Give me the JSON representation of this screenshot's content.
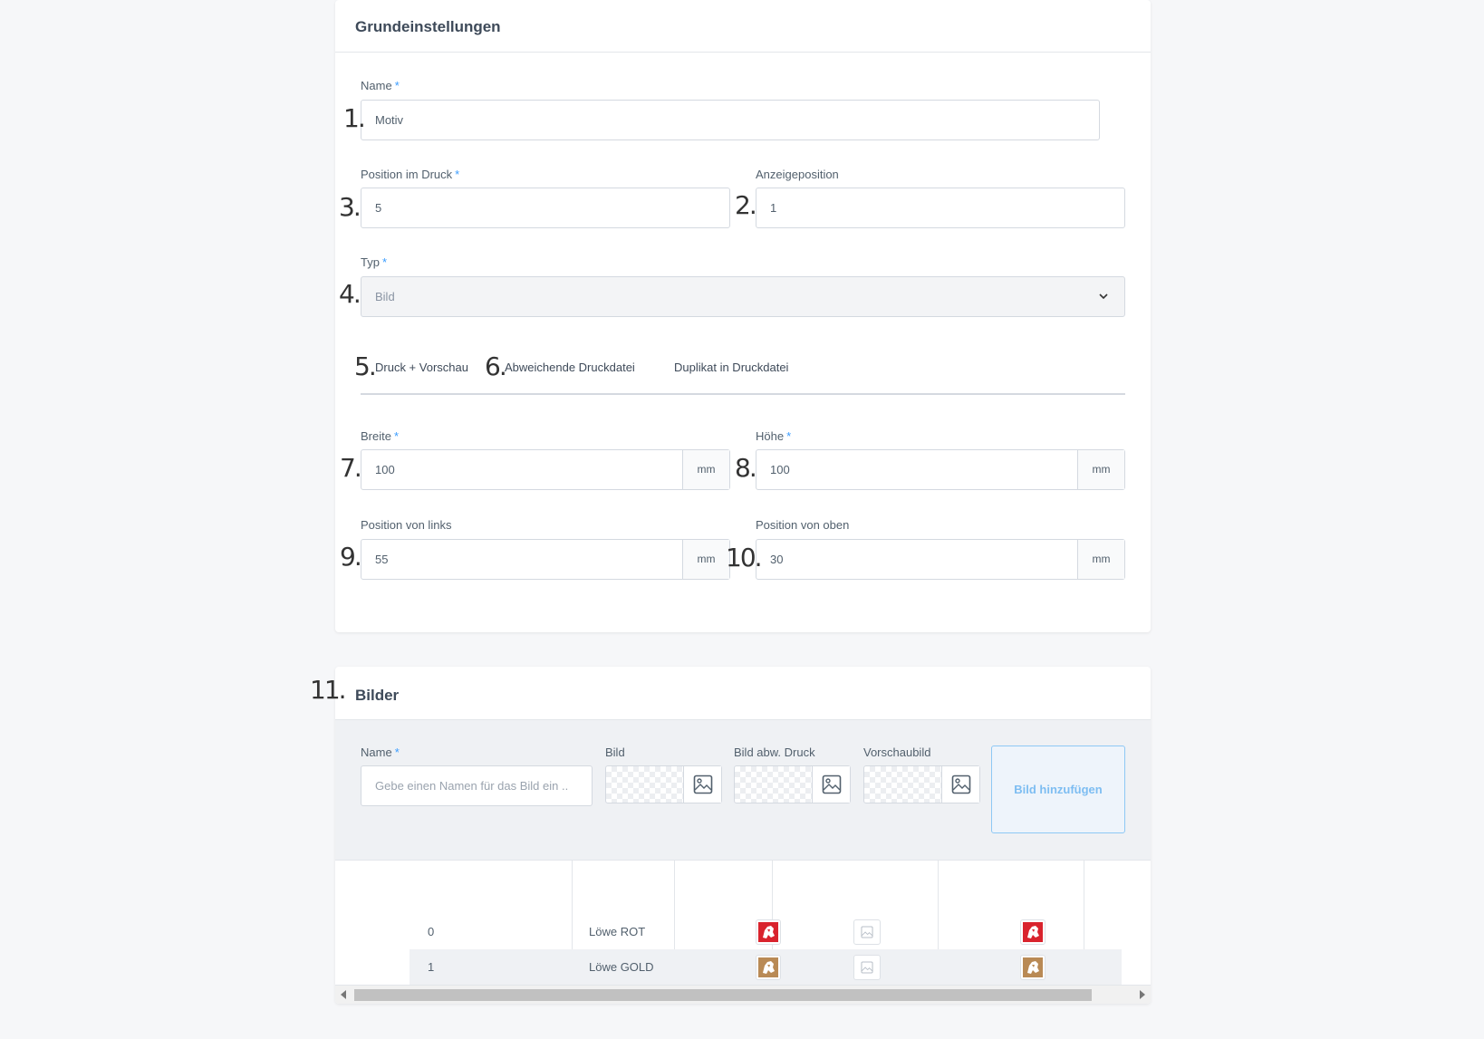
{
  "settings": {
    "title": "Grundeinstellungen",
    "required_mark": "*",
    "name": {
      "label": "Name",
      "value": "Motiv"
    },
    "position_print": {
      "label": "Position im Druck",
      "value": "5"
    },
    "display_position": {
      "label": "Anzeigeposition",
      "value": "1"
    },
    "type": {
      "label": "Typ",
      "value": "Bild"
    },
    "tabs": [
      "Druck + Vorschau",
      "Abweichende Druckdatei",
      "Duplikat in Druckdatei"
    ],
    "width": {
      "label": "Breite",
      "value": "100",
      "unit": "mm"
    },
    "height": {
      "label": "Höhe",
      "value": "100",
      "unit": "mm"
    },
    "pos_left": {
      "label": "Position von links",
      "value": "55",
      "unit": "mm"
    },
    "pos_top": {
      "label": "Position von oben",
      "value": "30",
      "unit": "mm"
    }
  },
  "annotations": [
    "1.",
    "2.",
    "3.",
    "4.",
    "5.",
    "6.",
    "7.",
    "8.",
    "9.",
    "10.",
    "11."
  ],
  "images": {
    "title": "Bilder",
    "form": {
      "name_label": "Name",
      "name_placeholder": "Gebe einen Namen für das Bild ein ..",
      "image_label": "Bild",
      "image_print_label": "Bild abw. Druck",
      "preview_label": "Vorschaubild",
      "add_button": "Bild hinzufügen"
    },
    "rows": [
      {
        "index": "0",
        "name": "Löwe ROT",
        "color": "#d9232d"
      },
      {
        "index": "1",
        "name": "Löwe GOLD",
        "color": "#b98a55"
      }
    ]
  },
  "icons": {
    "image": "image-icon",
    "chevron": "chevron-down-icon",
    "lion": "lion-icon"
  }
}
